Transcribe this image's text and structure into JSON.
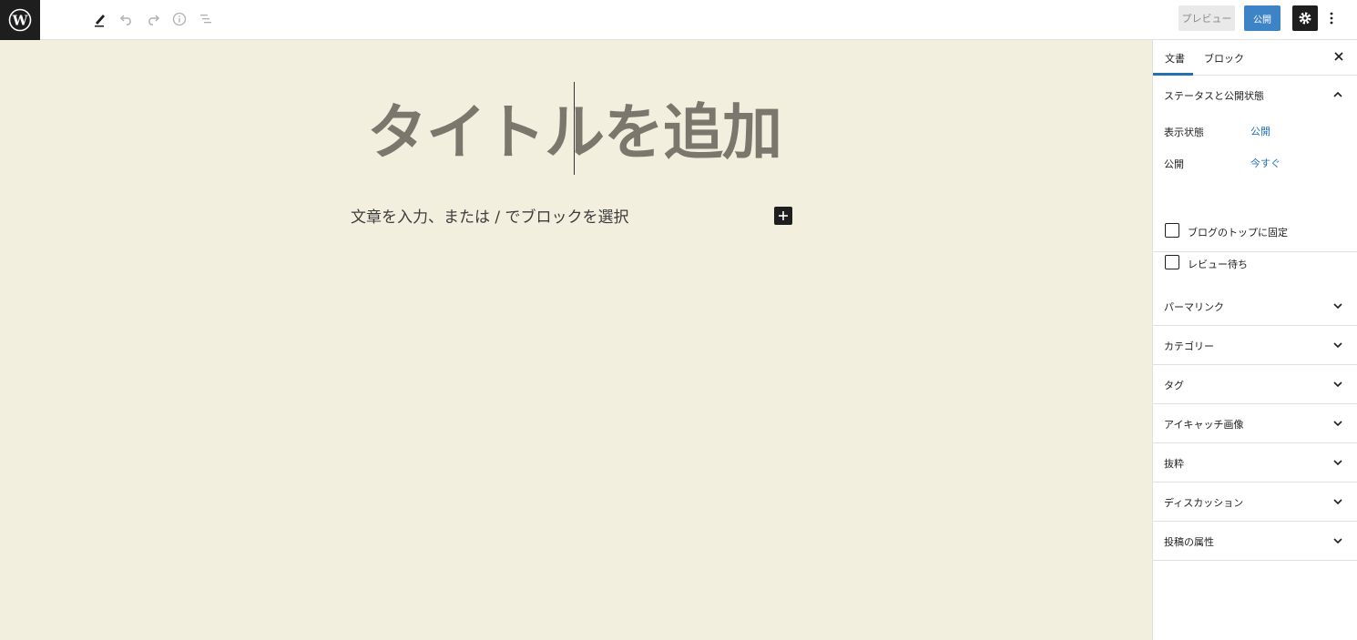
{
  "toolbar": {
    "add_label": "+",
    "preview_label": "プレビュー",
    "publish_label": "公開"
  },
  "icons": {
    "logo": "wordpress-logo",
    "tools": "pencil-icon",
    "undo": "undo-icon",
    "redo": "redo-icon",
    "info": "info-icon",
    "outline": "list-outline-icon",
    "settings": "gear-icon",
    "more": "vertical-dots-icon"
  },
  "editor": {
    "title_placeholder": "タイトルを追加",
    "paragraph_placeholder": "文章を入力、または / でブロックを選択"
  },
  "sidebar": {
    "tabs": [
      {
        "label": "文書"
      },
      {
        "label": "ブロック"
      }
    ],
    "status_panel": {
      "title": "ステータスと公開状態",
      "visibility_label": "表示状態",
      "visibility_value": "公開",
      "publish_label": "公開",
      "publish_value": "今すぐ",
      "sticky_label": "ブログのトップに固定",
      "pending_label": "レビュー待ち"
    },
    "panels": [
      {
        "title": "パーマリンク"
      },
      {
        "title": "カテゴリー"
      },
      {
        "title": "タグ"
      },
      {
        "title": "アイキャッチ画像"
      },
      {
        "title": "抜粋"
      },
      {
        "title": "ディスカッション"
      },
      {
        "title": "投稿の属性"
      }
    ]
  },
  "colors": {
    "accent": "#2271b1",
    "canvas_bg": "#f3efdf",
    "title_color": "#7a776d",
    "dark": "#1e1e1e"
  }
}
